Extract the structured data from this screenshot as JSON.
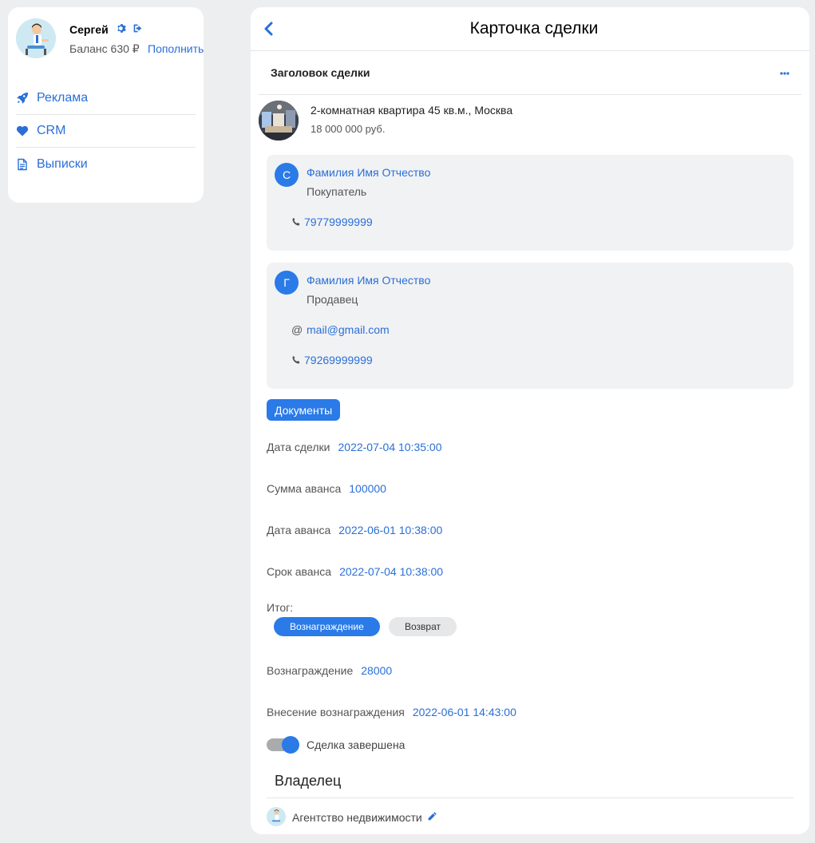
{
  "user": {
    "name": "Сергей",
    "balance_label": "Баланс 630 ₽",
    "topup_label": "Пополнить"
  },
  "nav": {
    "items": [
      {
        "label": "Реклама",
        "icon": "rocket-icon"
      },
      {
        "label": "CRM",
        "icon": "heart-icon"
      },
      {
        "label": "Выписки",
        "icon": "document-icon"
      }
    ]
  },
  "header": {
    "title": "Карточка сделки"
  },
  "deal": {
    "section_title": "Заголовок сделки",
    "property_title": "2-комнатная квартира 45 кв.м., Москва",
    "property_price": "18 000 000 руб."
  },
  "buyer": {
    "initial": "С",
    "name": "Фамилия Имя Отчество",
    "role": "Покупатель",
    "phone": "79779999999"
  },
  "seller": {
    "initial": "Г",
    "name": "Фамилия Имя Отчество",
    "role": "Продавец",
    "email_prefix": "@",
    "email": "mail@gmail.com",
    "phone": "79269999999"
  },
  "documents_label": "Документы",
  "fields": {
    "deal_date": {
      "label": "Дата сделки",
      "value": "2022-07-04 10:35:00"
    },
    "advance_sum": {
      "label": "Сумма аванса",
      "value": "100000"
    },
    "advance_date": {
      "label": "Дата аванса",
      "value": "2022-06-01 10:38:00"
    },
    "advance_term": {
      "label": "Срок аванса",
      "value": "2022-07-04 10:38:00"
    },
    "reward": {
      "label": "Вознаграждение",
      "value": "28000"
    },
    "reward_date": {
      "label": "Внесение вознаграждения",
      "value": "2022-06-01 14:43:00"
    }
  },
  "result": {
    "label": "Итог:",
    "options": [
      "Вознаграждение",
      "Возврат"
    ],
    "selected": "Вознаграждение"
  },
  "completed": {
    "label": "Сделка завершена",
    "on": true
  },
  "owner": {
    "title": "Владелец",
    "name": "Агентство недвижимости"
  },
  "colors": {
    "accent": "#2a7ae8",
    "link": "#2a6fd8",
    "background": "#edeef0"
  }
}
